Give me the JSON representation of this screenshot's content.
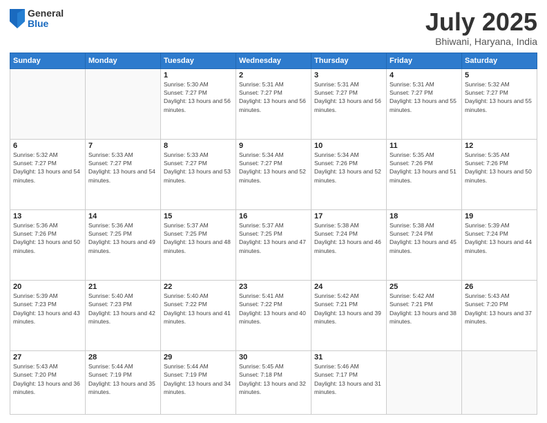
{
  "header": {
    "logo_general": "General",
    "logo_blue": "Blue",
    "month_title": "July 2025",
    "location": "Bhiwani, Haryana, India"
  },
  "weekdays": [
    "Sunday",
    "Monday",
    "Tuesday",
    "Wednesday",
    "Thursday",
    "Friday",
    "Saturday"
  ],
  "weeks": [
    [
      {
        "day": "",
        "info": ""
      },
      {
        "day": "",
        "info": ""
      },
      {
        "day": "1",
        "info": "Sunrise: 5:30 AM\nSunset: 7:27 PM\nDaylight: 13 hours and 56 minutes."
      },
      {
        "day": "2",
        "info": "Sunrise: 5:31 AM\nSunset: 7:27 PM\nDaylight: 13 hours and 56 minutes."
      },
      {
        "day": "3",
        "info": "Sunrise: 5:31 AM\nSunset: 7:27 PM\nDaylight: 13 hours and 56 minutes."
      },
      {
        "day": "4",
        "info": "Sunrise: 5:31 AM\nSunset: 7:27 PM\nDaylight: 13 hours and 55 minutes."
      },
      {
        "day": "5",
        "info": "Sunrise: 5:32 AM\nSunset: 7:27 PM\nDaylight: 13 hours and 55 minutes."
      }
    ],
    [
      {
        "day": "6",
        "info": "Sunrise: 5:32 AM\nSunset: 7:27 PM\nDaylight: 13 hours and 54 minutes."
      },
      {
        "day": "7",
        "info": "Sunrise: 5:33 AM\nSunset: 7:27 PM\nDaylight: 13 hours and 54 minutes."
      },
      {
        "day": "8",
        "info": "Sunrise: 5:33 AM\nSunset: 7:27 PM\nDaylight: 13 hours and 53 minutes."
      },
      {
        "day": "9",
        "info": "Sunrise: 5:34 AM\nSunset: 7:27 PM\nDaylight: 13 hours and 52 minutes."
      },
      {
        "day": "10",
        "info": "Sunrise: 5:34 AM\nSunset: 7:26 PM\nDaylight: 13 hours and 52 minutes."
      },
      {
        "day": "11",
        "info": "Sunrise: 5:35 AM\nSunset: 7:26 PM\nDaylight: 13 hours and 51 minutes."
      },
      {
        "day": "12",
        "info": "Sunrise: 5:35 AM\nSunset: 7:26 PM\nDaylight: 13 hours and 50 minutes."
      }
    ],
    [
      {
        "day": "13",
        "info": "Sunrise: 5:36 AM\nSunset: 7:26 PM\nDaylight: 13 hours and 50 minutes."
      },
      {
        "day": "14",
        "info": "Sunrise: 5:36 AM\nSunset: 7:25 PM\nDaylight: 13 hours and 49 minutes."
      },
      {
        "day": "15",
        "info": "Sunrise: 5:37 AM\nSunset: 7:25 PM\nDaylight: 13 hours and 48 minutes."
      },
      {
        "day": "16",
        "info": "Sunrise: 5:37 AM\nSunset: 7:25 PM\nDaylight: 13 hours and 47 minutes."
      },
      {
        "day": "17",
        "info": "Sunrise: 5:38 AM\nSunset: 7:24 PM\nDaylight: 13 hours and 46 minutes."
      },
      {
        "day": "18",
        "info": "Sunrise: 5:38 AM\nSunset: 7:24 PM\nDaylight: 13 hours and 45 minutes."
      },
      {
        "day": "19",
        "info": "Sunrise: 5:39 AM\nSunset: 7:24 PM\nDaylight: 13 hours and 44 minutes."
      }
    ],
    [
      {
        "day": "20",
        "info": "Sunrise: 5:39 AM\nSunset: 7:23 PM\nDaylight: 13 hours and 43 minutes."
      },
      {
        "day": "21",
        "info": "Sunrise: 5:40 AM\nSunset: 7:23 PM\nDaylight: 13 hours and 42 minutes."
      },
      {
        "day": "22",
        "info": "Sunrise: 5:40 AM\nSunset: 7:22 PM\nDaylight: 13 hours and 41 minutes."
      },
      {
        "day": "23",
        "info": "Sunrise: 5:41 AM\nSunset: 7:22 PM\nDaylight: 13 hours and 40 minutes."
      },
      {
        "day": "24",
        "info": "Sunrise: 5:42 AM\nSunset: 7:21 PM\nDaylight: 13 hours and 39 minutes."
      },
      {
        "day": "25",
        "info": "Sunrise: 5:42 AM\nSunset: 7:21 PM\nDaylight: 13 hours and 38 minutes."
      },
      {
        "day": "26",
        "info": "Sunrise: 5:43 AM\nSunset: 7:20 PM\nDaylight: 13 hours and 37 minutes."
      }
    ],
    [
      {
        "day": "27",
        "info": "Sunrise: 5:43 AM\nSunset: 7:20 PM\nDaylight: 13 hours and 36 minutes."
      },
      {
        "day": "28",
        "info": "Sunrise: 5:44 AM\nSunset: 7:19 PM\nDaylight: 13 hours and 35 minutes."
      },
      {
        "day": "29",
        "info": "Sunrise: 5:44 AM\nSunset: 7:19 PM\nDaylight: 13 hours and 34 minutes."
      },
      {
        "day": "30",
        "info": "Sunrise: 5:45 AM\nSunset: 7:18 PM\nDaylight: 13 hours and 32 minutes."
      },
      {
        "day": "31",
        "info": "Sunrise: 5:46 AM\nSunset: 7:17 PM\nDaylight: 13 hours and 31 minutes."
      },
      {
        "day": "",
        "info": ""
      },
      {
        "day": "",
        "info": ""
      }
    ]
  ]
}
